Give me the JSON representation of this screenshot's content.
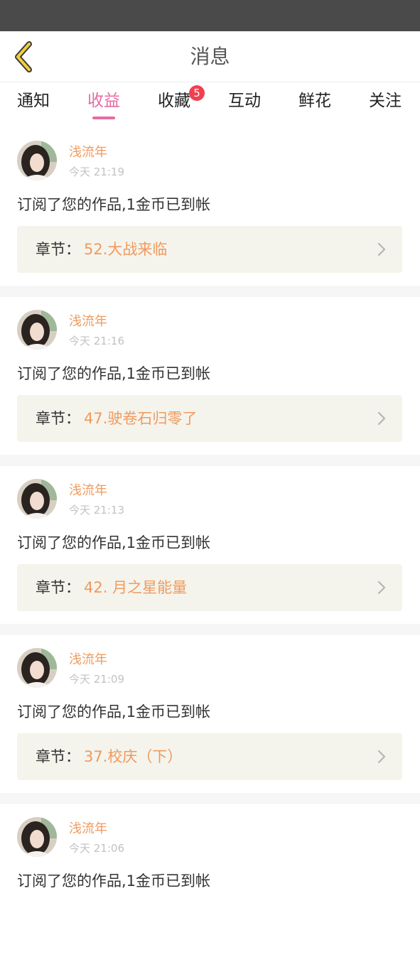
{
  "header": {
    "title": "消息"
  },
  "tabs": [
    {
      "label": "通知",
      "active": false
    },
    {
      "label": "收益",
      "active": true
    },
    {
      "label": "收藏",
      "active": false,
      "badge": "5"
    },
    {
      "label": "互动",
      "active": false
    },
    {
      "label": "鲜花",
      "active": false
    },
    {
      "label": "关注",
      "active": false
    }
  ],
  "chapter_label": "章节：",
  "messages": [
    {
      "user": "浅流年",
      "time": "今天 21:19",
      "text": "订阅了您的作品,1金币已到帐",
      "chapter": "52.大战来临"
    },
    {
      "user": "浅流年",
      "time": "今天 21:16",
      "text": "订阅了您的作品,1金币已到帐",
      "chapter": "47.驶卷石归零了"
    },
    {
      "user": "浅流年",
      "time": "今天 21:13",
      "text": "订阅了您的作品,1金币已到帐",
      "chapter": "42. 月之星能量"
    },
    {
      "user": "浅流年",
      "time": "今天 21:09",
      "text": "订阅了您的作品,1金币已到帐",
      "chapter": "37.校庆（下）"
    },
    {
      "user": "浅流年",
      "time": "今天 21:06",
      "text": "订阅了您的作品,1金币已到帐",
      "chapter": ""
    }
  ],
  "colors": {
    "accent": "#e86aa3",
    "username": "#f09a5e",
    "badge": "#f04050",
    "chapter_bg": "#f4f4ec"
  }
}
